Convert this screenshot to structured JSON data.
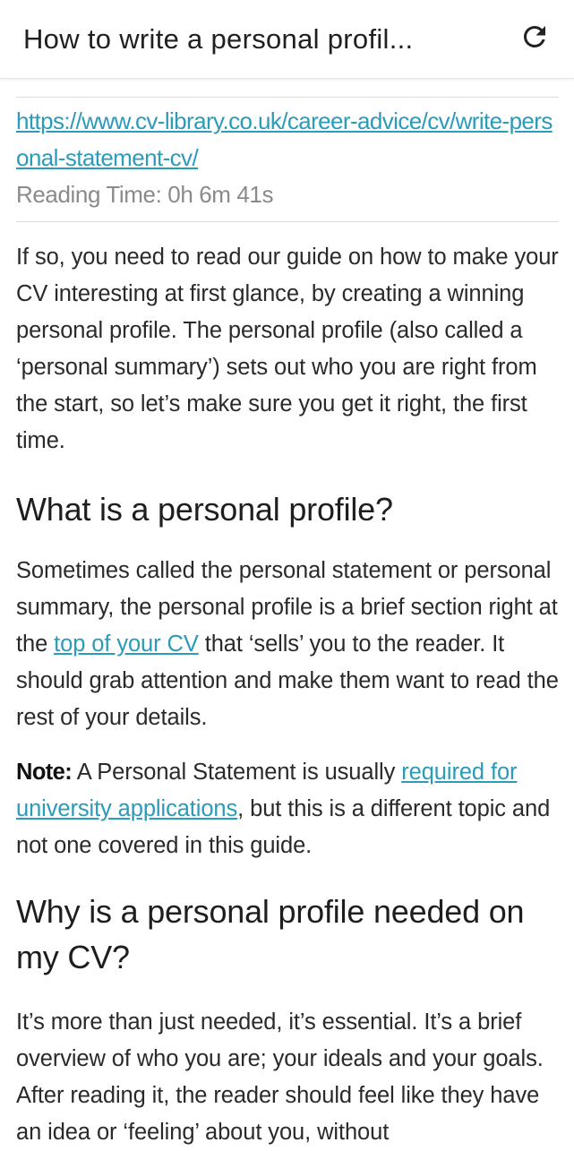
{
  "header": {
    "title": "How to write a personal profil...",
    "reload_icon": "reload-icon"
  },
  "article": {
    "source_url": "https://www.cv-library.co.uk/career-advice/cv/write-personal-statement-cv/",
    "reading_time": "Reading Time: 0h 6m 41s",
    "intro": "If so, you need to read our guide on how to make your CV interesting at first glance, by creating a winning personal profile. The personal profile (also called a ‘personal summary’) sets out who you are right from the start, so let’s make sure you get it right, the first time.",
    "section1": {
      "heading": "What is a personal profile?",
      "para_before_link": "Sometimes called the personal statement or personal summary, the personal profile is a brief section right at the ",
      "link_text": "top of your CV",
      "para_after_link": " that ‘sells’ you to the reader. It should grab attention and make them want to read the rest of your details."
    },
    "note": {
      "label": "Note:",
      "before_link": " A Personal Statement is usually ",
      "link_text": "required for university applications",
      "after_link": ", but this is a different topic and not one covered in this guide."
    },
    "section2": {
      "heading": "Why is a personal profile needed on my CV?",
      "para": "It’s more than just needed, it’s essential. It’s a brief overview of who you are; your ideals and your goals. After reading it, the reader should feel like they have an idea or ‘feeling’ about you, without"
    }
  },
  "colors": {
    "link": "#2a9bb8",
    "meta_text": "#8a8a8a"
  }
}
